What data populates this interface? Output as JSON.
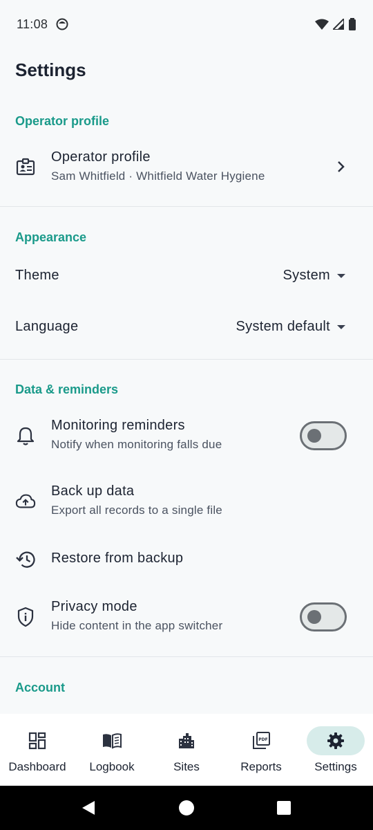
{
  "status_bar": {
    "time": "11:08"
  },
  "page": {
    "title": "Settings"
  },
  "sections": {
    "operator_profile": {
      "header": "Operator profile",
      "row": {
        "title": "Operator profile",
        "subtitle": "Sam Whitfield · Whitfield Water Hygiene"
      }
    },
    "appearance": {
      "header": "Appearance",
      "theme": {
        "label": "Theme",
        "value": "System"
      },
      "language": {
        "label": "Language",
        "value": "System default"
      }
    },
    "data_reminders": {
      "header": "Data & reminders",
      "monitoring": {
        "title": "Monitoring reminders",
        "subtitle": "Notify when monitoring falls due",
        "enabled": false
      },
      "backup": {
        "title": "Back up data",
        "subtitle": "Export all records to a single file"
      },
      "restore": {
        "title": "Restore from backup"
      },
      "privacy": {
        "title": "Privacy mode",
        "subtitle": "Hide content in the app switcher",
        "enabled": false
      }
    },
    "account": {
      "header": "Account"
    }
  },
  "bottom_nav": {
    "items": [
      {
        "label": "Dashboard",
        "icon": "dashboard-icon"
      },
      {
        "label": "Logbook",
        "icon": "book-icon"
      },
      {
        "label": "Sites",
        "icon": "buildings-icon"
      },
      {
        "label": "Reports",
        "icon": "pdf-icon"
      },
      {
        "label": "Settings",
        "icon": "gear-icon",
        "active": true
      }
    ]
  },
  "colors": {
    "accent": "#1a9a8a",
    "active_pill": "#d7ecea",
    "background": "#f7f9fa"
  }
}
